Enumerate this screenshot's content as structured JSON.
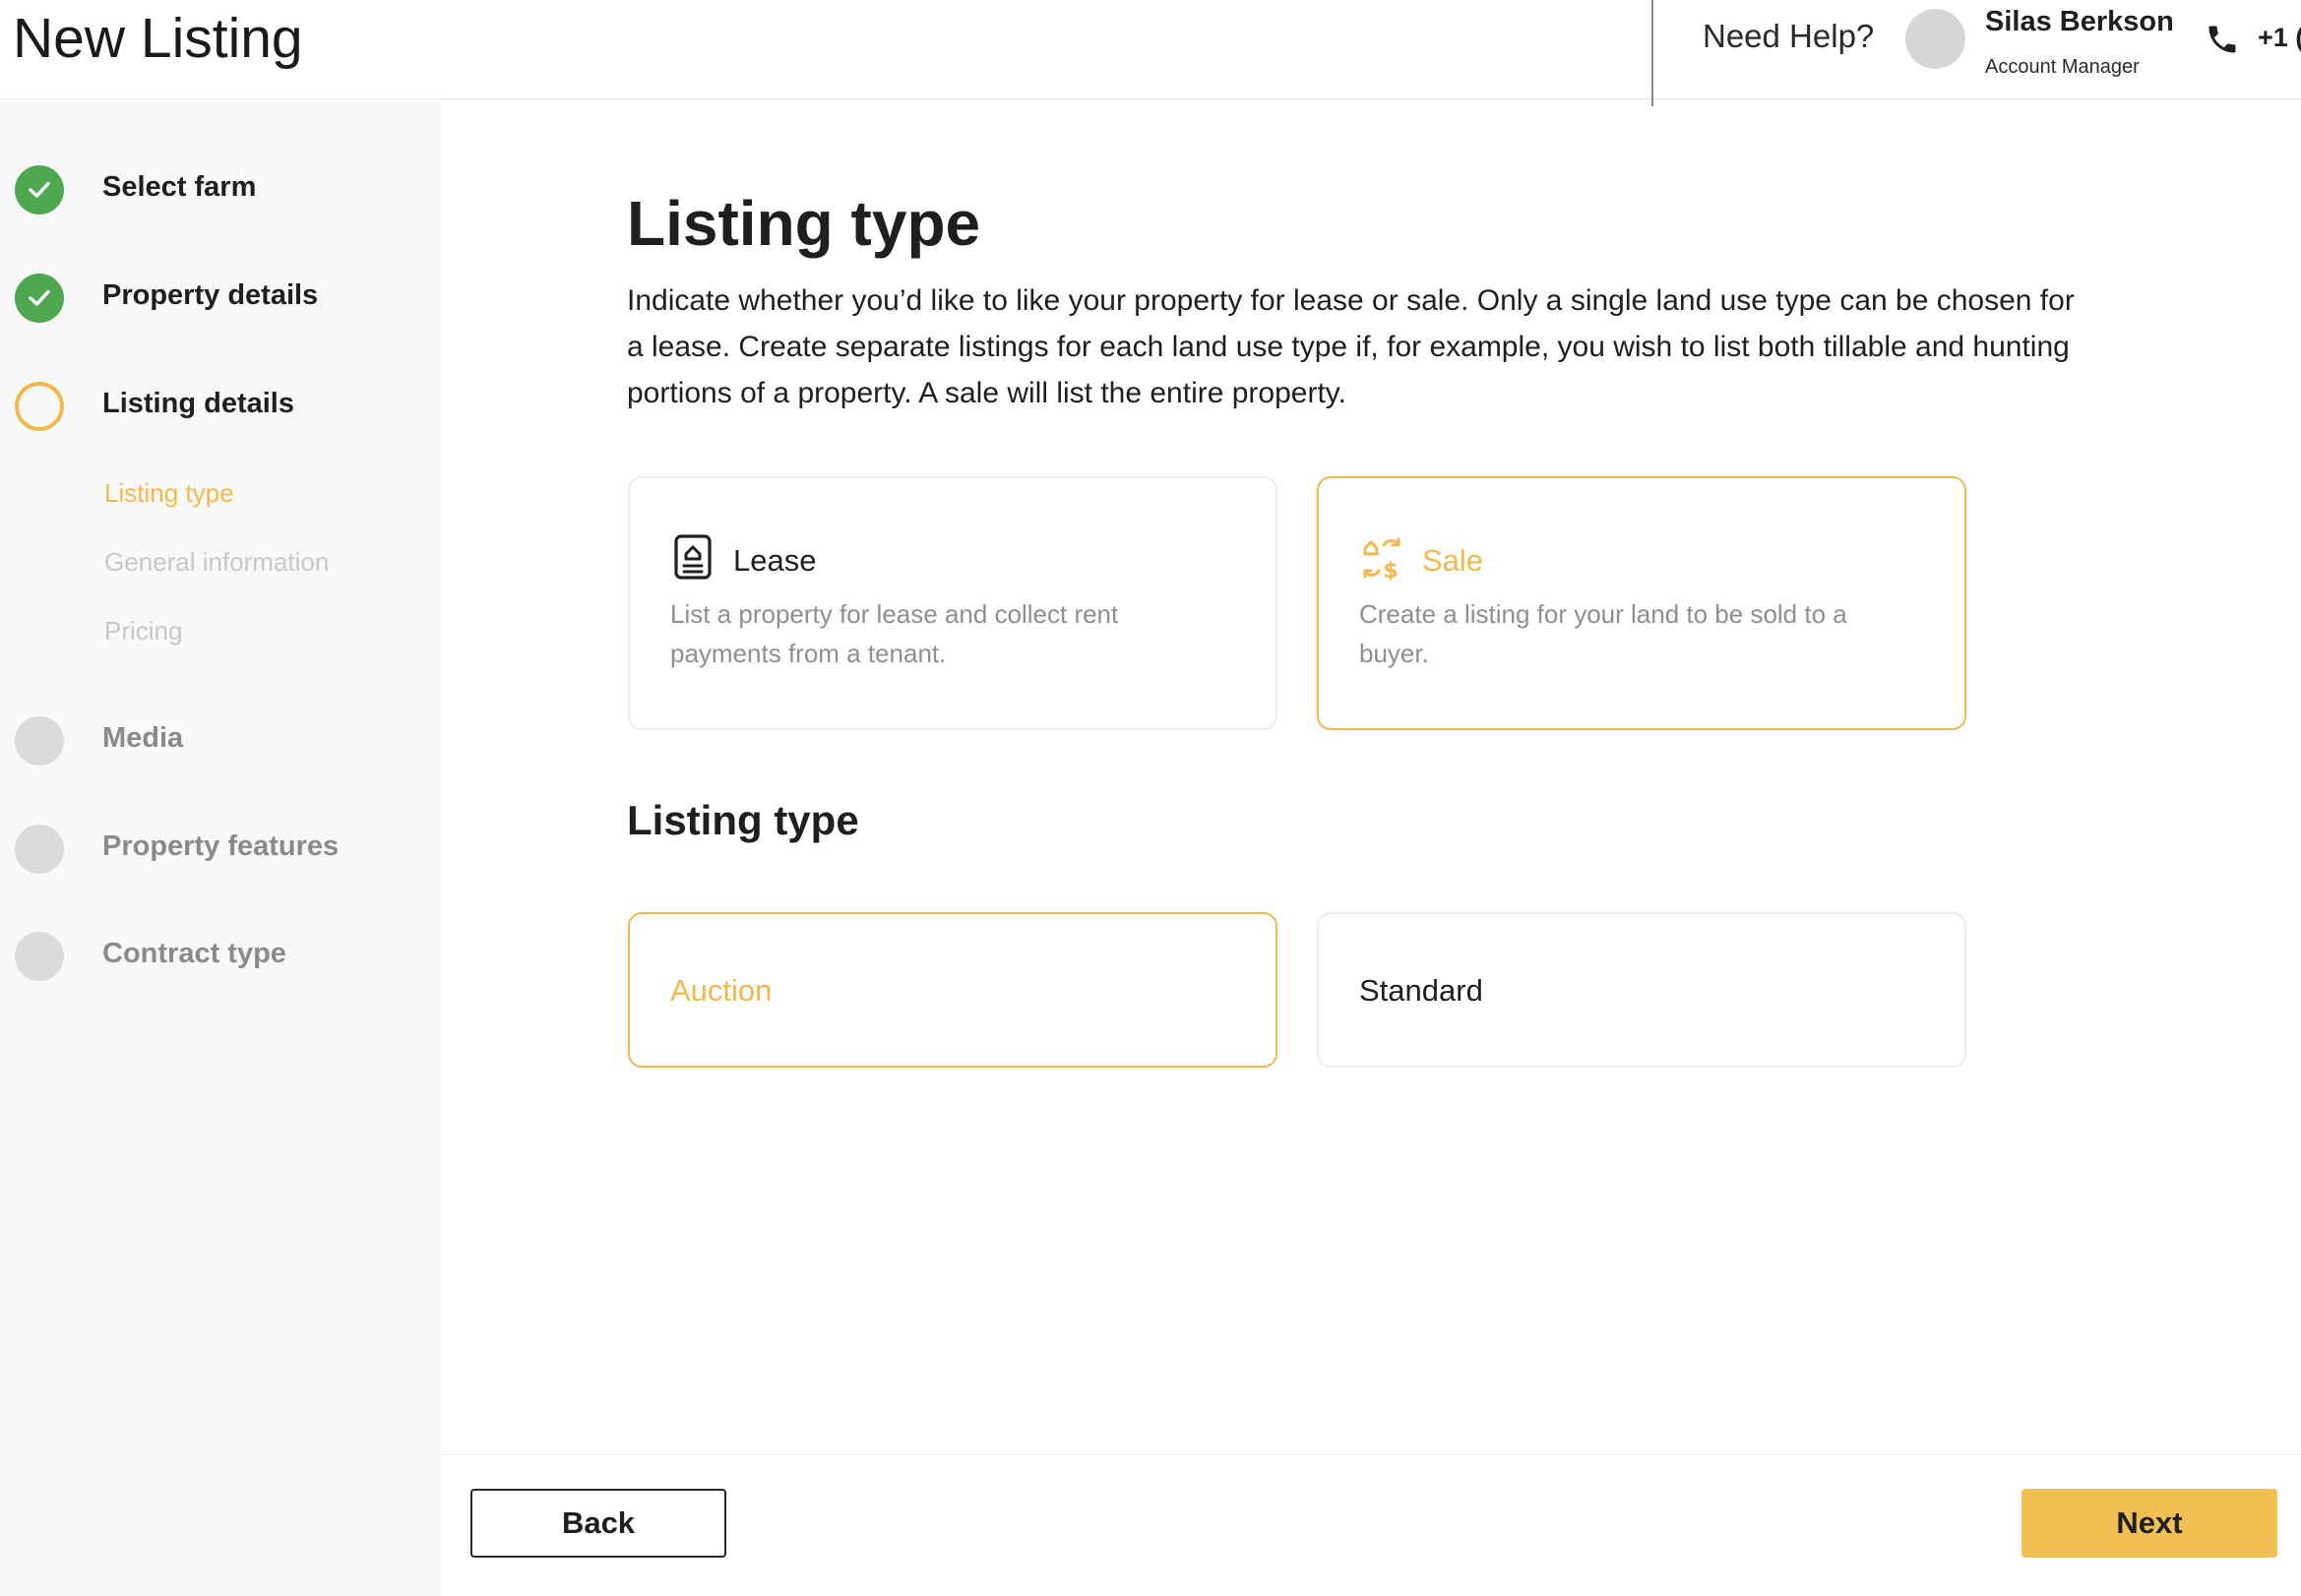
{
  "header": {
    "title": "New Listing",
    "help": "Need Help?",
    "user_name": "Silas Berkson",
    "user_role": "Account Manager",
    "phone": "+1 ("
  },
  "sidebar": {
    "steps": [
      {
        "label": "Select farm",
        "state": "done"
      },
      {
        "label": "Property details",
        "state": "done"
      },
      {
        "label": "Listing details",
        "state": "current"
      },
      {
        "label": "Media",
        "state": "todo"
      },
      {
        "label": "Property features",
        "state": "todo"
      },
      {
        "label": "Contract type",
        "state": "todo"
      }
    ],
    "substeps": [
      {
        "label": "Listing type",
        "state": "active"
      },
      {
        "label": "General information",
        "state": "todo"
      },
      {
        "label": "Pricing",
        "state": "todo"
      }
    ]
  },
  "main": {
    "title": "Listing type",
    "description": "Indicate whether you’d like to like your property for lease or sale. Only a single land use type can be chosen for a lease. Create separate listings for each land use type if, for example, you wish to list both tillable and hunting portions of a property. A sale will list the entire property.",
    "listing_options": [
      {
        "title": "Lease",
        "description": "List a property for lease and collect rent payments from a tenant.",
        "icon": "lease-document-icon",
        "selected": false
      },
      {
        "title": "Sale",
        "description": "Create a listing for your land to be sold to a buyer.",
        "icon": "sale-exchange-icon",
        "selected": true
      }
    ],
    "section_title": "Listing type",
    "sale_types": [
      {
        "label": "Auction",
        "selected": true
      },
      {
        "label": "Standard",
        "selected": false
      }
    ]
  },
  "footer": {
    "back_label": "Back",
    "next_label": "Next"
  },
  "colors": {
    "accent": "#f2b84b",
    "done": "#4fa84f",
    "next_button": "#f2bf55"
  }
}
